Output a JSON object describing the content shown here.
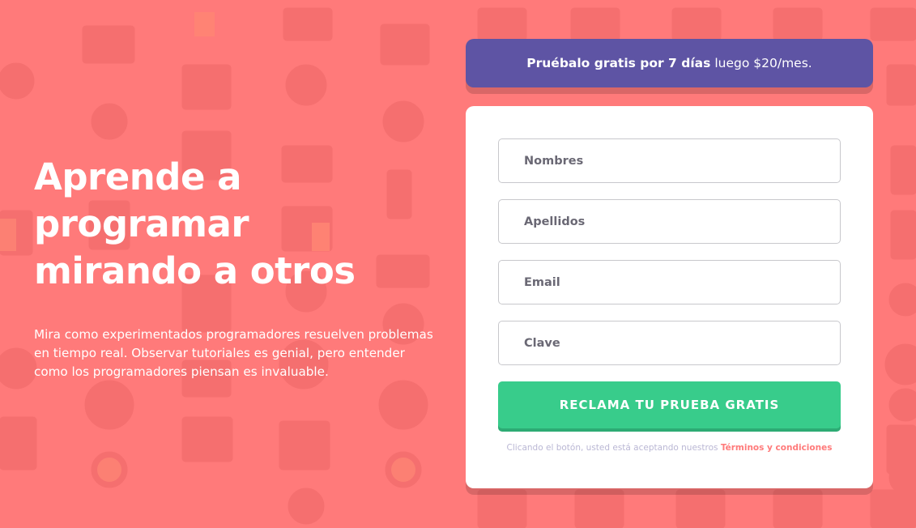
{
  "hero": {
    "title": "Aprende a programar mirando a otros",
    "description": "Mira como experimentados programadores resuelven problemas en tiempo real. Observar tutoriales es genial, pero entender como los programadores piensan es invaluable."
  },
  "promo": {
    "bold": "Pruébalo gratis por 7 días",
    "rest": "luego $20/mes."
  },
  "form": {
    "first_name_placeholder": "Nombres",
    "last_name_placeholder": "Apellidos",
    "email_placeholder": "Email",
    "password_placeholder": "Clave",
    "submit_label": "RECLAMA TU PRUEBA GRATIS",
    "terms_prefix": "Clicando el botón, usted está aceptando nuestros",
    "terms_link": "Términos y condiciones"
  },
  "colors": {
    "background": "#ff7a7a",
    "promo": "#5e54a4",
    "submit": "#38cc8b",
    "card": "#ffffff",
    "terms_link": "#ff7a7a"
  },
  "icons": {
    "background_pattern": [
      "browser-window-icon",
      "toolbox-icon",
      "headset-icon",
      "network-icon",
      "thumbs-up-icon",
      "chart-icon",
      "rocket-icon",
      "lifebuoy-icon",
      "calendar-icon",
      "lightbulb-icon",
      "gear-icon"
    ]
  }
}
